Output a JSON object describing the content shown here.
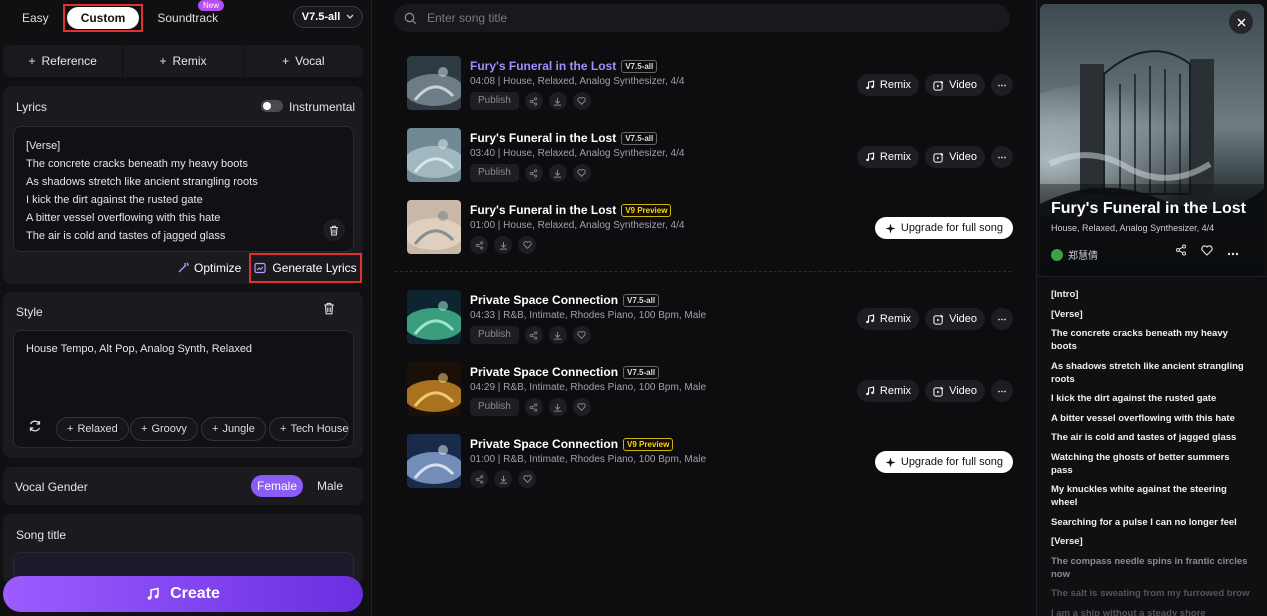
{
  "modes": {
    "easy": "Easy",
    "custom": "Custom",
    "soundtrack": "Soundtrack",
    "new_badge": "New"
  },
  "version": "V7.5-all",
  "add_buttons": [
    "Reference",
    "Remix",
    "Vocal"
  ],
  "lyrics": {
    "title": "Lyrics",
    "instrumental": "Instrumental",
    "lines": [
      "[Verse]",
      "The concrete cracks beneath my heavy boots",
      "As shadows stretch like ancient strangling roots",
      "I kick the dirt against the rusted gate",
      "A bitter vessel overflowing with this hate",
      "The air is cold and tastes of jagged glass"
    ],
    "optimize": "Optimize",
    "generate": "Generate Lyrics"
  },
  "style": {
    "title": "Style",
    "value": "House Tempo, Alt Pop, Analog Synth, Relaxed",
    "chips": [
      "Relaxed",
      "Groovy",
      "Jungle",
      "Tech House"
    ]
  },
  "vocal_gender": {
    "title": "Vocal Gender",
    "female": "Female",
    "male": "Male"
  },
  "song_title": {
    "title": "Song title"
  },
  "create": "Create",
  "search": {
    "placeholder": "Enter song title"
  },
  "songs": [
    {
      "title": "Fury's Funeral in the Lost",
      "badge": "V7.5-all",
      "preview": false,
      "meta": "04:08 | House, Relaxed, Analog Synthesizer, 4/4",
      "publish": true,
      "remix": "Remix",
      "video": "Video"
    },
    {
      "title": "Fury's Funeral in the Lost",
      "badge": "V7.5-all",
      "preview": false,
      "meta": "03:40 | House, Relaxed, Analog Synthesizer, 4/4",
      "publish": true,
      "remix": "Remix",
      "video": "Video"
    },
    {
      "title": "Fury's Funeral in the Lost",
      "badge": "V9 Preview",
      "preview": true,
      "meta": "01:00 | House, Relaxed, Analog Synthesizer, 4/4",
      "publish": false,
      "upgrade": "Upgrade for full song"
    },
    {
      "title": "Private Space Connection",
      "badge": "V7.5-all",
      "preview": false,
      "meta": "04:33 | R&B, Intimate, Rhodes Piano, 100 Bpm, Male",
      "publish": true,
      "remix": "Remix",
      "video": "Video"
    },
    {
      "title": "Private Space Connection",
      "badge": "V7.5-all",
      "preview": false,
      "meta": "04:29 | R&B, Intimate, Rhodes Piano, 100 Bpm, Male",
      "publish": true,
      "remix": "Remix",
      "video": "Video"
    },
    {
      "title": "Private Space Connection",
      "badge": "V9 Preview",
      "preview": true,
      "meta": "01:00 | R&B, Intimate, Rhodes Piano, 100 Bpm, Male",
      "publish": false,
      "upgrade": "Upgrade for full song"
    }
  ],
  "publish_label": "Publish",
  "detail": {
    "title": "Fury's Funeral in the Lost",
    "subtitle": "House, Relaxed, Analog Synthesizer, 4/4",
    "user": "郑慧倩",
    "lyrics": [
      "[Intro]",
      "[Verse]",
      "The concrete cracks beneath my heavy boots",
      "As shadows stretch like ancient strangling roots",
      "I kick the dirt against the rusted gate",
      "A bitter vessel overflowing with this hate",
      "The air is cold and tastes of jagged glass",
      "Watching the ghosts of better summers pass",
      "My knuckles white against the steering wheel",
      "Searching for a pulse I can no longer feel",
      "[Verse]",
      "The compass needle spins in frantic circles now",
      "The salt is sweating from my furrowed brow",
      "I am a ship without a steady shore"
    ]
  },
  "colors": {
    "accent": "#8b5cf6",
    "highlight": "#e03030",
    "preview": "#ffd800"
  }
}
